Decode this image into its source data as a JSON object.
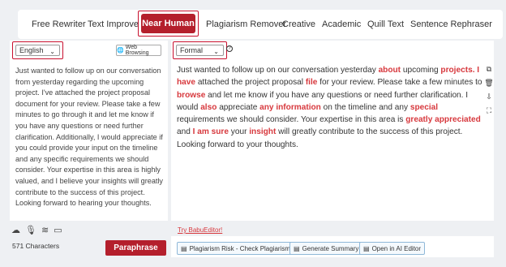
{
  "tabs": [
    "Free Rewriter",
    "Text Improver",
    "Near Human",
    "Plagiarism Remover",
    "Creative",
    "Academic",
    "Quill Text",
    "Sentence Rephraser"
  ],
  "active_tab": "Near Human",
  "language": {
    "value": "English"
  },
  "web_browsing": "Web Browsing",
  "tone": {
    "value": "Formal"
  },
  "input_text": "Just wanted to follow up on our conversation from yesterday regarding the upcoming project. I've attached the project proposal document for your review. Please take a few minutes to go through it and let me know if you have any questions or need further clarification. Additionally, I would appreciate if you could provide your input on the timeline and any specific requirements we should consider. Your expertise in this area is highly valued, and I believe your insights will greatly contribute to the success of this project. Looking forward to hearing your thoughts.",
  "output_segments": [
    {
      "t": "Just wanted to follow up on our conversation yesterday ",
      "h": false
    },
    {
      "t": "about",
      "h": true
    },
    {
      "t": " upcoming ",
      "h": false
    },
    {
      "t": "projects. I have",
      "h": true
    },
    {
      "t": " attached the project proposal ",
      "h": false
    },
    {
      "t": "file",
      "h": true
    },
    {
      "t": " for your review. Please take a few minutes to ",
      "h": false
    },
    {
      "t": "browse",
      "h": true
    },
    {
      "t": " and let me know if you have any questions or need further clarification. I would ",
      "h": false
    },
    {
      "t": "also",
      "h": true
    },
    {
      "t": " appreciate ",
      "h": false
    },
    {
      "t": "any information",
      "h": true
    },
    {
      "t": " on the timeline and any ",
      "h": false
    },
    {
      "t": "special",
      "h": true
    },
    {
      "t": " requirements we should consider. Your expertise in this area is ",
      "h": false
    },
    {
      "t": "greatly appreciated",
      "h": true
    },
    {
      "t": " and ",
      "h": false
    },
    {
      "t": "I am sure",
      "h": true
    },
    {
      "t": " your ",
      "h": false
    },
    {
      "t": "insight",
      "h": true
    },
    {
      "t": " will greatly contribute to the success of this project. Looking forward to your thoughts.",
      "h": false
    }
  ],
  "char_count": "571 Characters",
  "paraphrase": "Paraphrase",
  "try_link": "Try BabuEditor!",
  "actions": {
    "plagiarism": "Plagiarism Risk - Check Plagiarism",
    "summary": "Generate Summary",
    "ai_editor": "Open in AI Editor"
  },
  "icons": [
    "cloud-upload-icon",
    "microphone-icon",
    "audio-wave-icon",
    "image-icon",
    "copy-icon",
    "delete-icon",
    "cloud-download-icon",
    "expand-icon",
    "globe-icon",
    "info-icon"
  ]
}
